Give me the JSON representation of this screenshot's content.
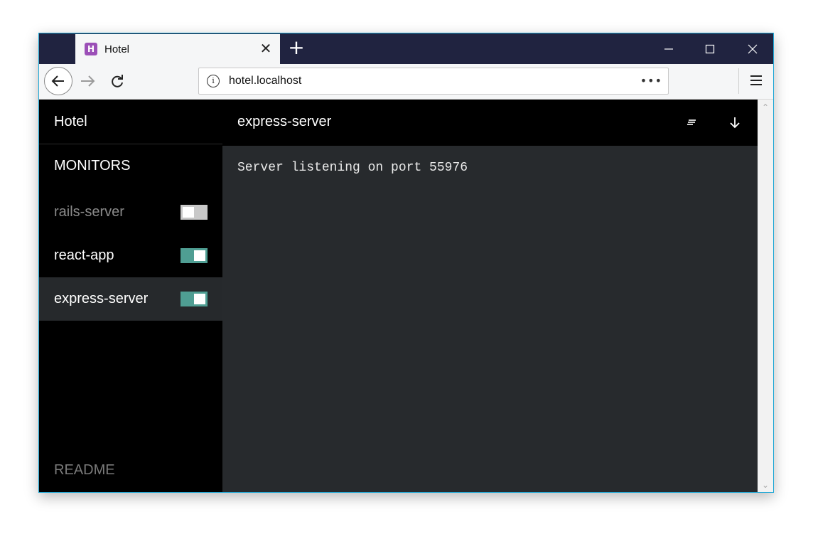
{
  "browser": {
    "tab": {
      "favicon_letter": "H",
      "favicon_color": "#9b4fb7",
      "title": "Hotel",
      "close_glyph": "✕"
    },
    "new_tab_glyph": "+",
    "window_controls": [
      "minimize-icon",
      "maximize-icon",
      "close-icon"
    ],
    "url": "hotel.localhost",
    "url_info_glyph": "i",
    "url_more_glyph": "•••"
  },
  "app": {
    "title": "Hotel",
    "section_label": "MONITORS",
    "monitors": [
      {
        "name": "rails-server",
        "enabled": false,
        "active": false
      },
      {
        "name": "react-app",
        "enabled": true,
        "active": false
      },
      {
        "name": "express-server",
        "enabled": true,
        "active": true
      }
    ],
    "readme_label": "README",
    "accent_color": "#4f9e93",
    "main": {
      "title": "express-server",
      "log_lines": [
        "Server listening on port 55976"
      ]
    }
  }
}
